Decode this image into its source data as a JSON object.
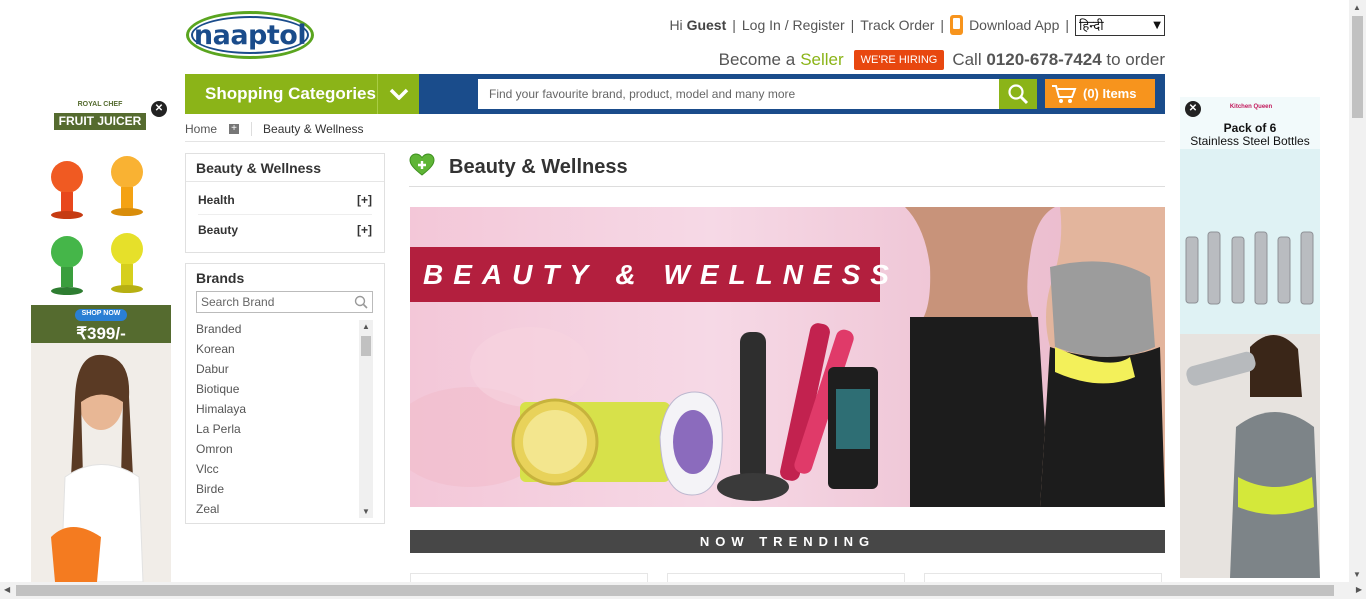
{
  "logo": {
    "text": "naaptol"
  },
  "top_links": {
    "greeting_prefix": "Hi",
    "greeting_user": "Guest",
    "login": "Log In / Register",
    "track_order": "Track Order",
    "download_app": "Download App",
    "language": "हिन्दी"
  },
  "seller_line": {
    "become": "Become a",
    "seller": "Seller",
    "hiring": "WE'RE HIRING",
    "call": "Call",
    "phone": "0120-678-7424",
    "to_order": "to order"
  },
  "nav": {
    "shopping_categories": "Shopping Categories",
    "search_placeholder": "Find your favourite brand, product, model and many more",
    "cart_label": "(0) Items"
  },
  "breadcrumb": {
    "home": "Home",
    "current": "Beauty & Wellness"
  },
  "category_panel": {
    "title": "Beauty & Wellness",
    "items": [
      {
        "label": "Health",
        "toggle": "[+]"
      },
      {
        "label": "Beauty",
        "toggle": "[+]"
      }
    ]
  },
  "brands_panel": {
    "title": "Brands",
    "search_placeholder": "Search Brand",
    "items": [
      "Branded",
      "Korean",
      "Dabur",
      "Biotique",
      "Himalaya",
      "La Perla",
      "Omron",
      "Vlcc",
      "Birde",
      "Zeal"
    ]
  },
  "main": {
    "title": "Beauty & Wellness",
    "banner_text": "BEAUTY & WELLNESS",
    "trending": "NOW TRENDING"
  },
  "ad_left": {
    "brand": "ROYAL CHEF",
    "product": "FRUIT JUICER",
    "cta": "SHOP NOW",
    "price": "₹399/-"
  },
  "ad_right": {
    "brand": "Kitchen Queen",
    "line1": "Pack of 6",
    "line2": "Stainless Steel Bottles"
  },
  "colors": {
    "brand_blue": "#1a4c8b",
    "brand_green": "#8bb418",
    "cart_orange": "#f7941d",
    "hiring_red": "#e8470f",
    "banner_red": "#b31f3e"
  }
}
